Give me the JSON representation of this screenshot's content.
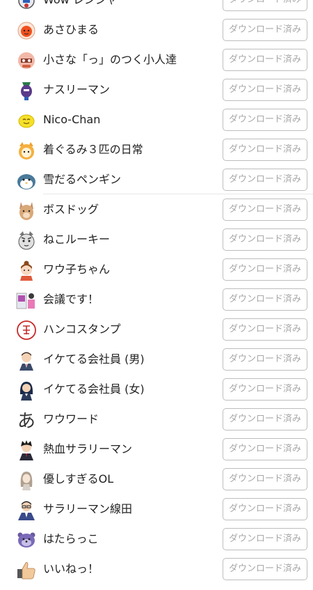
{
  "stickers": [
    {
      "name": "Wow レンジャー",
      "icon": "ranger-icon",
      "button": "ダウンロード済み"
    },
    {
      "name": "あさひまる",
      "icon": "sun-mascot-icon",
      "button": "ダウンロード済み"
    },
    {
      "name": "小さな「っ」のつく小人達",
      "icon": "little-people-icon",
      "button": "ダウンロード済み"
    },
    {
      "name": "ナスリーマン",
      "icon": "eggplant-man-icon",
      "button": "ダウンロード済み"
    },
    {
      "name": "Nico-Chan",
      "icon": "smiley-face-icon",
      "button": "ダウンロード済み"
    },
    {
      "name": "着ぐるみ３匹の日常",
      "icon": "costume-cat-icon",
      "button": "ダウンロード済み"
    },
    {
      "name": "雪だるペンギン",
      "icon": "snow-penguin-icon",
      "button": "ダウンロード済み"
    },
    {
      "name": "ボスドッグ",
      "icon": "boss-dog-icon",
      "button": "ダウンロード済み"
    },
    {
      "name": "ねこルーキー",
      "icon": "cat-rookie-icon",
      "button": "ダウンロード済み"
    },
    {
      "name": "ワウ子ちゃん",
      "icon": "girl-icon",
      "button": "ダウンロード済み"
    },
    {
      "name": "会議です！",
      "icon": "meeting-icon",
      "button": "ダウンロード済み"
    },
    {
      "name": "ハンコスタンプ",
      "icon": "hanko-seal-icon",
      "button": "ダウンロード済み"
    },
    {
      "name": "イケてる会社員 (男)",
      "icon": "office-man-icon",
      "button": "ダウンロード済み"
    },
    {
      "name": "イケてる会社員 (女)",
      "icon": "office-woman-icon",
      "button": "ダウンロード済み"
    },
    {
      "name": "ワウワード",
      "icon": "character-a-icon",
      "button": "ダウンロード済み"
    },
    {
      "name": "熱血サラリーマン",
      "icon": "hot-salaryman-icon",
      "button": "ダウンロード済み"
    },
    {
      "name": "優しすぎるOL",
      "icon": "gentle-ol-icon",
      "button": "ダウンロード済み"
    },
    {
      "name": "サラリーマン線田",
      "icon": "salaryman-senda-icon",
      "button": "ダウンロード済み"
    },
    {
      "name": "はたらっこ",
      "icon": "otter-icon",
      "button": "ダウンロード済み"
    },
    {
      "name": "いいねっ！",
      "icon": "thumbs-up-icon",
      "button": "ダウンロード済み"
    }
  ],
  "colors": {
    "text": "#222222",
    "button_text": "#a8a8a8",
    "button_border": "#bdbdbd",
    "divider": "#e8e8e8"
  }
}
